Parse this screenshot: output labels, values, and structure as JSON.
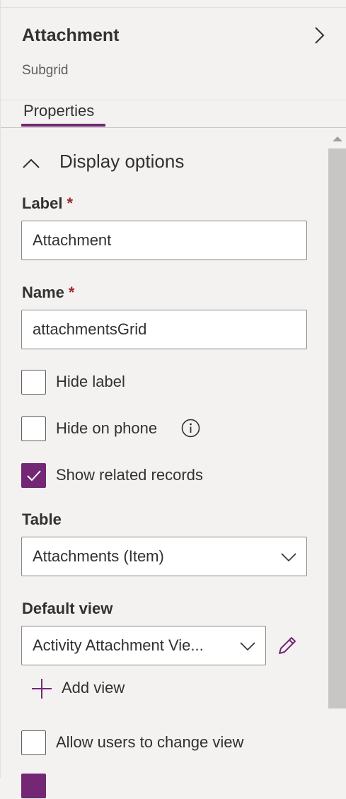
{
  "panel": {
    "title": "Attachment",
    "subtitle": "Subgrid",
    "tabs": [
      {
        "label": "Properties",
        "active": true
      }
    ]
  },
  "section": {
    "title": "Display options",
    "expanded": true
  },
  "fields": {
    "label": {
      "label": "Label",
      "required_mark": "*",
      "value": "Attachment"
    },
    "name": {
      "label": "Name",
      "required_mark": "*",
      "value": "attachmentsGrid"
    },
    "table": {
      "label": "Table",
      "value": "Attachments (Item)"
    },
    "default_view": {
      "label": "Default view",
      "value": "Activity Attachment Vie..."
    }
  },
  "checkboxes": {
    "hide_label": {
      "label": "Hide label",
      "checked": false
    },
    "hide_on_phone": {
      "label": "Hide on phone",
      "checked": false
    },
    "show_related": {
      "label": "Show related records",
      "checked": true
    },
    "allow_change_view": {
      "label": "Allow users to change view",
      "checked": false
    },
    "next_item": {
      "label": "",
      "checked": true
    }
  },
  "actions": {
    "add_view": "Add view"
  },
  "icons": {
    "close_panel": "chevron-right-icon",
    "collapse": "chevron-up-icon",
    "info": "info-icon",
    "dropdown": "chevron-down-icon",
    "edit": "pencil-icon",
    "add": "plus-icon",
    "check": "checkmark-icon"
  },
  "colors": {
    "accent": "#742774",
    "required": "#a4262c",
    "background": "#f3f2f1"
  }
}
